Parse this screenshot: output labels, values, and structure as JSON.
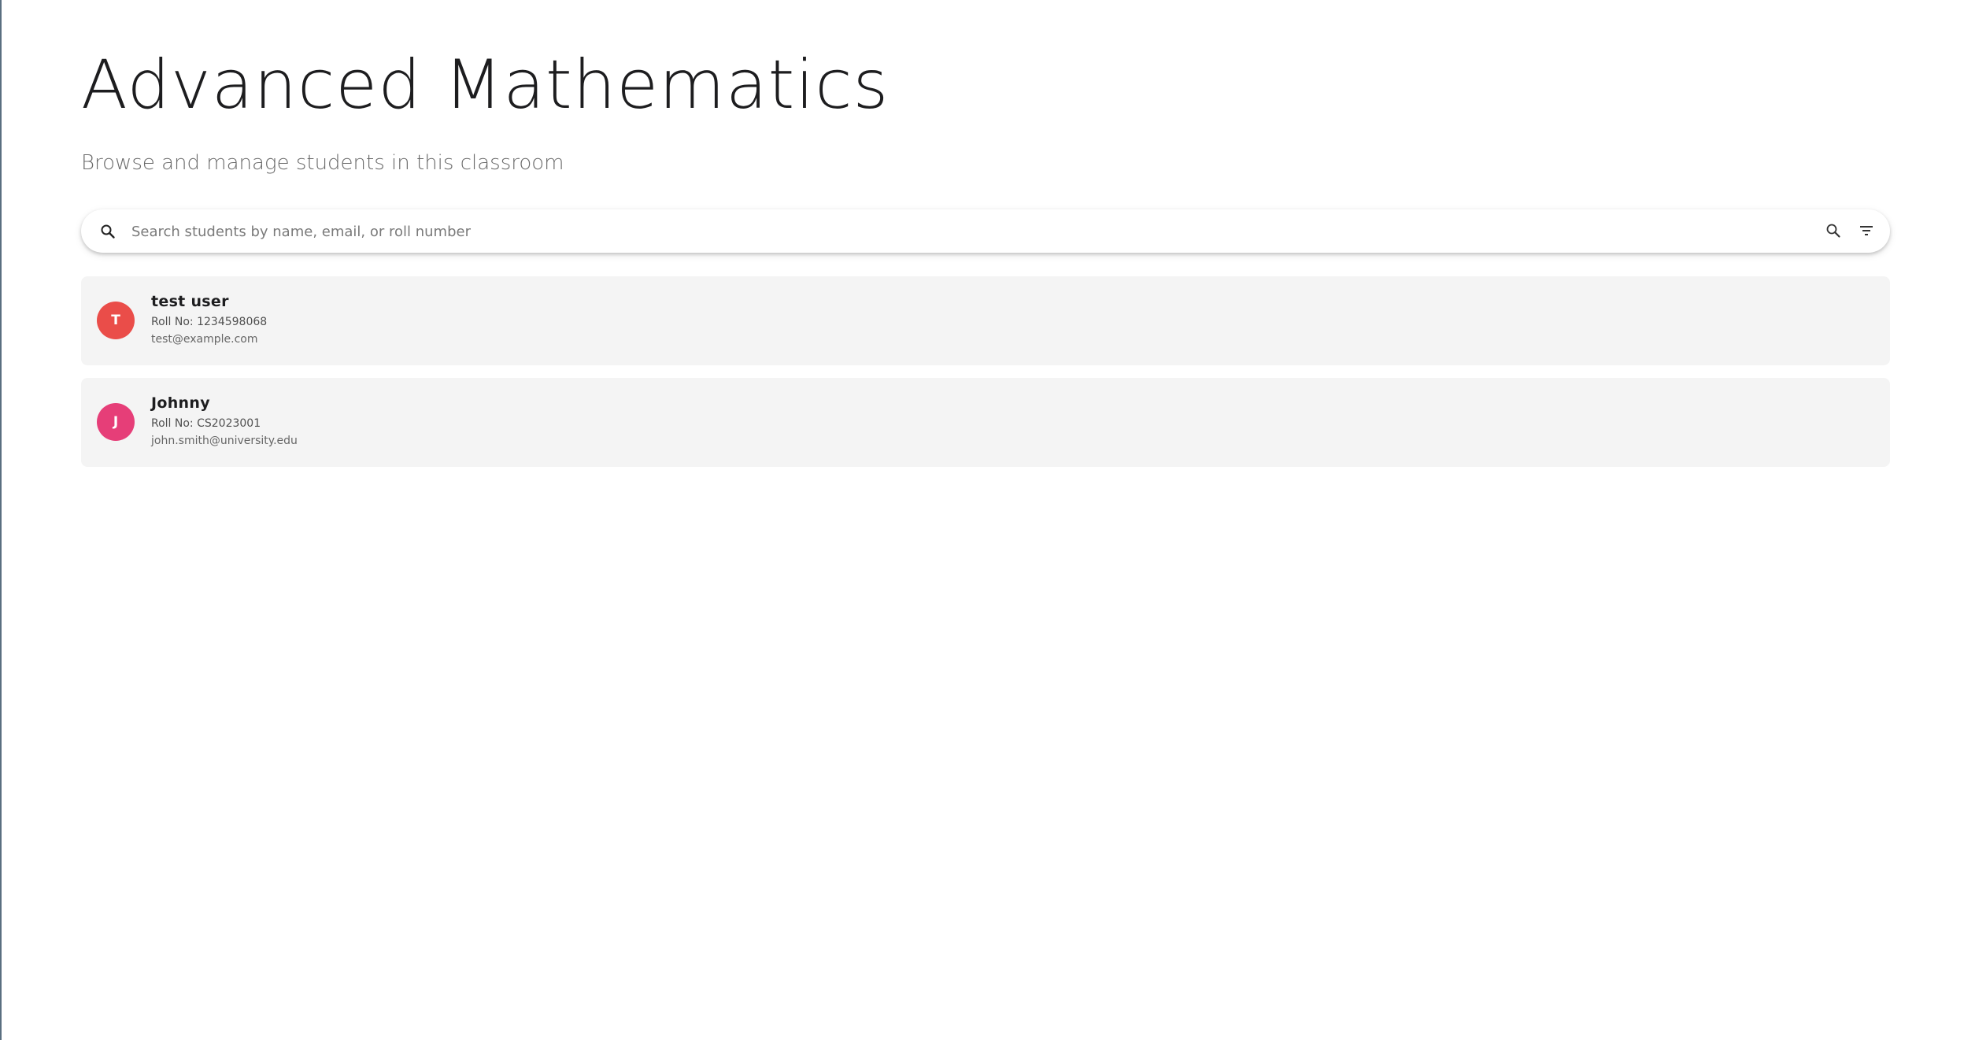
{
  "header": {
    "title": "Advanced Mathematics",
    "subtitle": "Browse and manage students in this classroom"
  },
  "search": {
    "placeholder": "Search students by name, email, or roll number",
    "value": "",
    "leading_icon": "search-icon",
    "trailing_icons": [
      "search-icon",
      "filter-icon"
    ]
  },
  "students": [
    {
      "initial": "T",
      "name": "test user",
      "roll": "Roll No: 1234598068",
      "email": "test@example.com",
      "avatar_color": "#ea4d49"
    },
    {
      "initial": "J",
      "name": "Johnny",
      "roll": "Roll No: CS2023001",
      "email": "john.smith@university.edu",
      "avatar_color": "#e63e78"
    }
  ]
}
